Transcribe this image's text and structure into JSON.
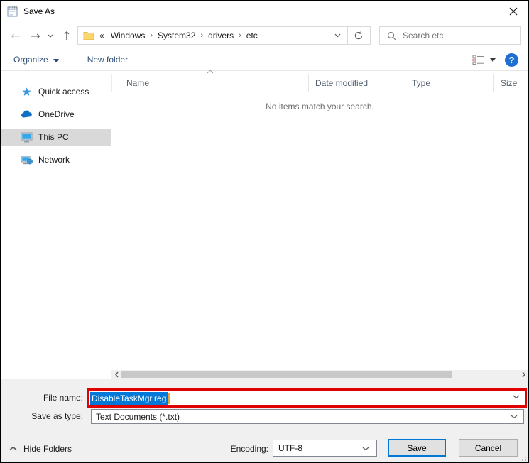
{
  "window": {
    "title": "Save As"
  },
  "nav": {
    "breadcrumb": {
      "root_symbol": "«",
      "separator": "›",
      "items": [
        "Windows",
        "System32",
        "drivers",
        "etc"
      ]
    },
    "search": {
      "placeholder": "Search etc"
    }
  },
  "toolbar": {
    "organize_label": "Organize",
    "new_folder_label": "New folder",
    "help_label": "?"
  },
  "sidebar": {
    "items": [
      {
        "label": "Quick access",
        "icon": "star-icon",
        "selected": false
      },
      {
        "label": "OneDrive",
        "icon": "cloud-icon",
        "selected": false
      },
      {
        "label": "This PC",
        "icon": "monitor-icon",
        "selected": true
      },
      {
        "label": "Network",
        "icon": "network-icon",
        "selected": false
      }
    ]
  },
  "filelist": {
    "columns": [
      "Name",
      "Date modified",
      "Type",
      "Size"
    ],
    "empty_message": "No items match your search."
  },
  "fields": {
    "file_name_label": "File name:",
    "file_name_value": "DisableTaskMgr.reg",
    "save_as_type_label": "Save as type:",
    "save_as_type_value": "Text Documents (*.txt)"
  },
  "footer": {
    "hide_folders_label": "Hide Folders",
    "encoding_label": "Encoding:",
    "encoding_value": "UTF-8",
    "save_label": "Save",
    "cancel_label": "Cancel"
  },
  "colors": {
    "accent": "#0078d7",
    "annotation_red": "#e10000",
    "selection_blue": "#0078d7",
    "toolbar_text": "#2b4d76"
  }
}
